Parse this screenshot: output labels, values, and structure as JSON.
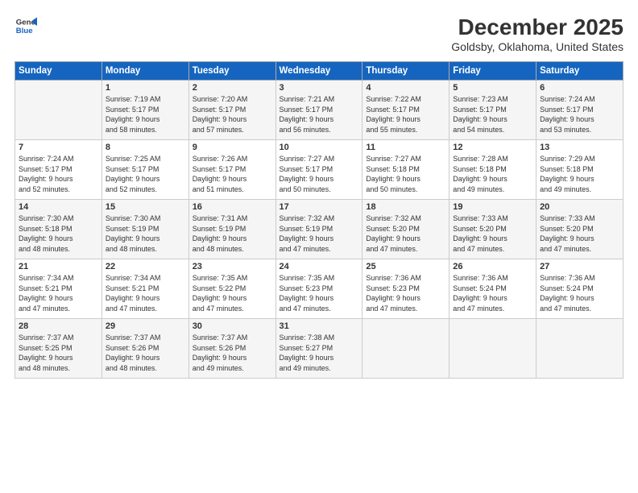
{
  "header": {
    "logo_line1": "General",
    "logo_line2": "Blue",
    "title": "December 2025",
    "subtitle": "Goldsby, Oklahoma, United States"
  },
  "columns": [
    "Sunday",
    "Monday",
    "Tuesday",
    "Wednesday",
    "Thursday",
    "Friday",
    "Saturday"
  ],
  "weeks": [
    [
      {
        "day": "",
        "info": ""
      },
      {
        "day": "1",
        "info": "Sunrise: 7:19 AM\nSunset: 5:17 PM\nDaylight: 9 hours\nand 58 minutes."
      },
      {
        "day": "2",
        "info": "Sunrise: 7:20 AM\nSunset: 5:17 PM\nDaylight: 9 hours\nand 57 minutes."
      },
      {
        "day": "3",
        "info": "Sunrise: 7:21 AM\nSunset: 5:17 PM\nDaylight: 9 hours\nand 56 minutes."
      },
      {
        "day": "4",
        "info": "Sunrise: 7:22 AM\nSunset: 5:17 PM\nDaylight: 9 hours\nand 55 minutes."
      },
      {
        "day": "5",
        "info": "Sunrise: 7:23 AM\nSunset: 5:17 PM\nDaylight: 9 hours\nand 54 minutes."
      },
      {
        "day": "6",
        "info": "Sunrise: 7:24 AM\nSunset: 5:17 PM\nDaylight: 9 hours\nand 53 minutes."
      }
    ],
    [
      {
        "day": "7",
        "info": "Sunrise: 7:24 AM\nSunset: 5:17 PM\nDaylight: 9 hours\nand 52 minutes."
      },
      {
        "day": "8",
        "info": "Sunrise: 7:25 AM\nSunset: 5:17 PM\nDaylight: 9 hours\nand 52 minutes."
      },
      {
        "day": "9",
        "info": "Sunrise: 7:26 AM\nSunset: 5:17 PM\nDaylight: 9 hours\nand 51 minutes."
      },
      {
        "day": "10",
        "info": "Sunrise: 7:27 AM\nSunset: 5:17 PM\nDaylight: 9 hours\nand 50 minutes."
      },
      {
        "day": "11",
        "info": "Sunrise: 7:27 AM\nSunset: 5:18 PM\nDaylight: 9 hours\nand 50 minutes."
      },
      {
        "day": "12",
        "info": "Sunrise: 7:28 AM\nSunset: 5:18 PM\nDaylight: 9 hours\nand 49 minutes."
      },
      {
        "day": "13",
        "info": "Sunrise: 7:29 AM\nSunset: 5:18 PM\nDaylight: 9 hours\nand 49 minutes."
      }
    ],
    [
      {
        "day": "14",
        "info": "Sunrise: 7:30 AM\nSunset: 5:18 PM\nDaylight: 9 hours\nand 48 minutes."
      },
      {
        "day": "15",
        "info": "Sunrise: 7:30 AM\nSunset: 5:19 PM\nDaylight: 9 hours\nand 48 minutes."
      },
      {
        "day": "16",
        "info": "Sunrise: 7:31 AM\nSunset: 5:19 PM\nDaylight: 9 hours\nand 48 minutes."
      },
      {
        "day": "17",
        "info": "Sunrise: 7:32 AM\nSunset: 5:19 PM\nDaylight: 9 hours\nand 47 minutes."
      },
      {
        "day": "18",
        "info": "Sunrise: 7:32 AM\nSunset: 5:20 PM\nDaylight: 9 hours\nand 47 minutes."
      },
      {
        "day": "19",
        "info": "Sunrise: 7:33 AM\nSunset: 5:20 PM\nDaylight: 9 hours\nand 47 minutes."
      },
      {
        "day": "20",
        "info": "Sunrise: 7:33 AM\nSunset: 5:20 PM\nDaylight: 9 hours\nand 47 minutes."
      }
    ],
    [
      {
        "day": "21",
        "info": "Sunrise: 7:34 AM\nSunset: 5:21 PM\nDaylight: 9 hours\nand 47 minutes."
      },
      {
        "day": "22",
        "info": "Sunrise: 7:34 AM\nSunset: 5:21 PM\nDaylight: 9 hours\nand 47 minutes."
      },
      {
        "day": "23",
        "info": "Sunrise: 7:35 AM\nSunset: 5:22 PM\nDaylight: 9 hours\nand 47 minutes."
      },
      {
        "day": "24",
        "info": "Sunrise: 7:35 AM\nSunset: 5:23 PM\nDaylight: 9 hours\nand 47 minutes."
      },
      {
        "day": "25",
        "info": "Sunrise: 7:36 AM\nSunset: 5:23 PM\nDaylight: 9 hours\nand 47 minutes."
      },
      {
        "day": "26",
        "info": "Sunrise: 7:36 AM\nSunset: 5:24 PM\nDaylight: 9 hours\nand 47 minutes."
      },
      {
        "day": "27",
        "info": "Sunrise: 7:36 AM\nSunset: 5:24 PM\nDaylight: 9 hours\nand 47 minutes."
      }
    ],
    [
      {
        "day": "28",
        "info": "Sunrise: 7:37 AM\nSunset: 5:25 PM\nDaylight: 9 hours\nand 48 minutes."
      },
      {
        "day": "29",
        "info": "Sunrise: 7:37 AM\nSunset: 5:26 PM\nDaylight: 9 hours\nand 48 minutes."
      },
      {
        "day": "30",
        "info": "Sunrise: 7:37 AM\nSunset: 5:26 PM\nDaylight: 9 hours\nand 49 minutes."
      },
      {
        "day": "31",
        "info": "Sunrise: 7:38 AM\nSunset: 5:27 PM\nDaylight: 9 hours\nand 49 minutes."
      },
      {
        "day": "",
        "info": ""
      },
      {
        "day": "",
        "info": ""
      },
      {
        "day": "",
        "info": ""
      }
    ]
  ]
}
